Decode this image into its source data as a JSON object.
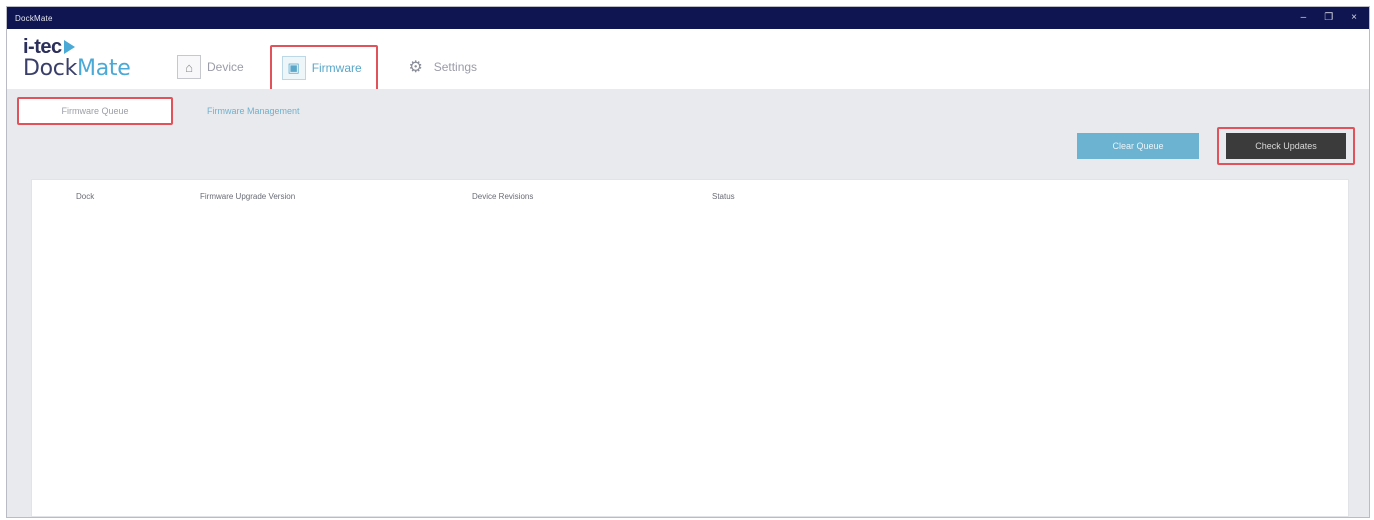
{
  "window": {
    "title": "DockMate",
    "controls": {
      "minimize": "–",
      "maximize": "❐",
      "close": "×"
    }
  },
  "logo": {
    "top": "i-tec",
    "bottom_main": "Dock",
    "bottom_accent": "Mate"
  },
  "nav": {
    "items": [
      {
        "label": "Device",
        "icon": "device-icon",
        "glyph": "⌂"
      },
      {
        "label": "Firmware",
        "icon": "firmware-icon",
        "glyph": "▣"
      },
      {
        "label": "Settings",
        "icon": "gear-icon",
        "glyph": "⚙"
      }
    ],
    "active": "Firmware"
  },
  "subtabs": {
    "items": [
      "Firmware Queue",
      "Firmware Management"
    ],
    "active": "Firmware Queue"
  },
  "buttons": {
    "primary": "Clear Queue",
    "dark": "Check Updates"
  },
  "table": {
    "columns": [
      "Dock",
      "Firmware Upgrade Version",
      "Device Revisions",
      "Status"
    ],
    "rows": []
  },
  "colors": {
    "titlebar": "#0e1550",
    "highlight": "#e2525a",
    "accent": "#6cb3d2",
    "dark_button": "#3b3b3b"
  }
}
